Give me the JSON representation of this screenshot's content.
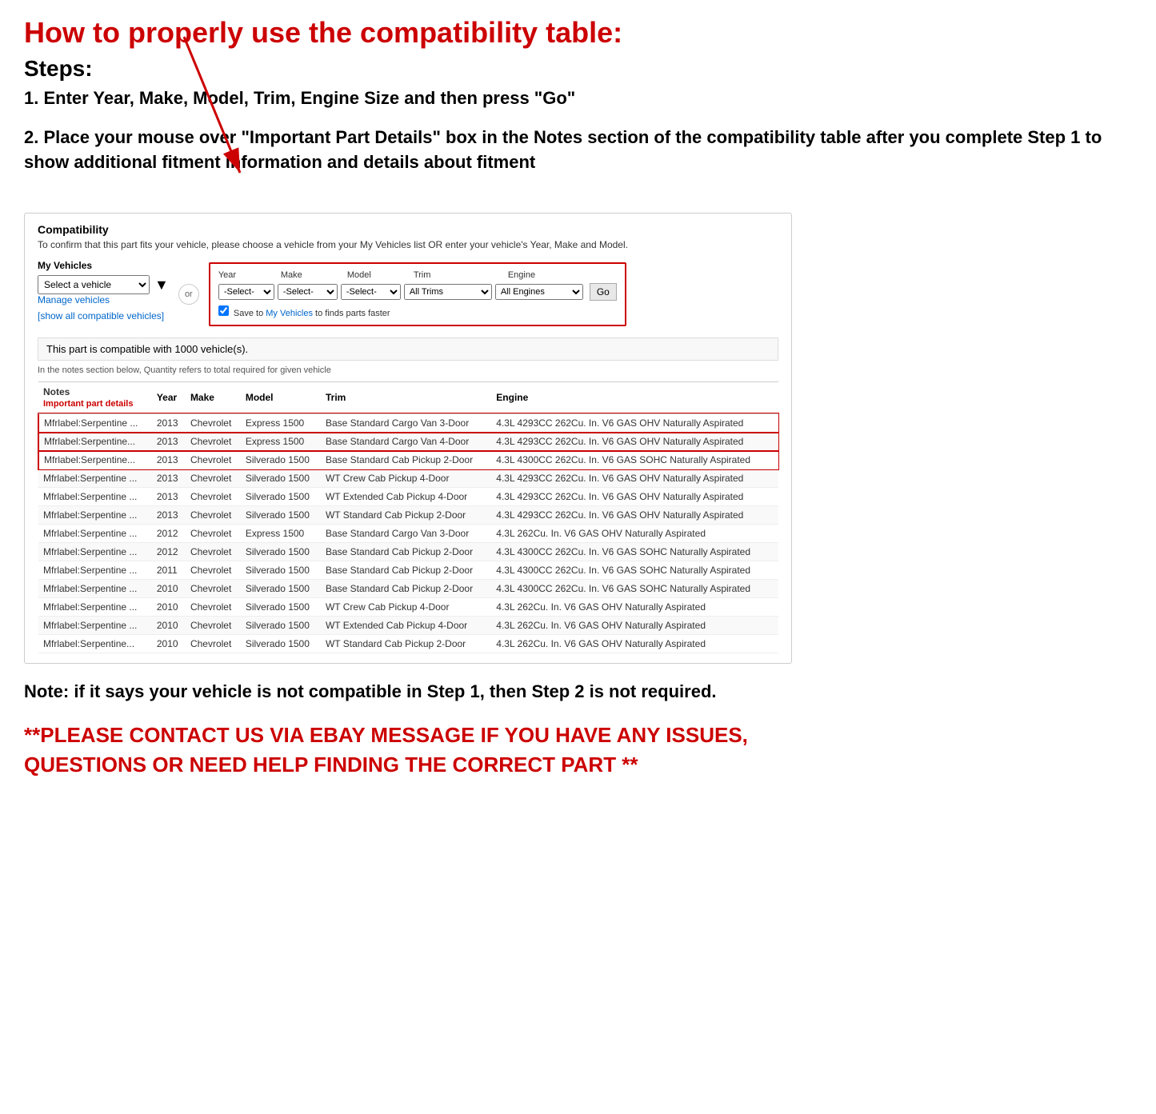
{
  "header": {
    "main_title": "How to properly use the compatibility table:",
    "steps_title": "Steps:",
    "step1": "1. Enter Year, Make, Model, Trim, Engine Size and then press \"Go\"",
    "step2": "2. Place your mouse over \"Important Part Details\" box in the Notes section of the compatibility table after you complete Step 1 to show additional fitment information and details about fitment"
  },
  "compatibility": {
    "title": "Compatibility",
    "subtitle": "To confirm that this part fits your vehicle, please choose a vehicle from your My Vehicles list OR enter your vehicle's Year, Make and Model.",
    "my_vehicles_label": "My Vehicles",
    "select_vehicle_placeholder": "Select a vehicle",
    "or_label": "or",
    "manage_vehicles": "Manage vehicles",
    "show_all": "[show all compatible vehicles]",
    "year_label": "Year",
    "make_label": "Make",
    "model_label": "Model",
    "trim_label": "Trim",
    "engine_label": "Engine",
    "year_value": "-Select-",
    "make_value": "-Select-",
    "model_value": "-Select-",
    "trim_value": "All Trims",
    "engine_value": "All Engines",
    "go_button": "Go",
    "save_text": "Save to",
    "my_vehicles_link": "My Vehicles",
    "save_suffix": "to finds parts faster",
    "count_text": "This part is compatible with 1000 vehicle(s).",
    "note_quantity": "In the notes section below, Quantity refers to total required for given vehicle",
    "table": {
      "headers": [
        "Notes",
        "Year",
        "Make",
        "Model",
        "Trim",
        "Engine"
      ],
      "notes_sub": "Important part details",
      "rows": [
        {
          "notes": "Mfrlabel:Serpentine ...",
          "year": "2013",
          "make": "Chevrolet",
          "model": "Express 1500",
          "trim": "Base Standard Cargo Van 3-Door",
          "engine": "4.3L 4293CC 262Cu. In. V6 GAS OHV Naturally Aspirated",
          "highlight": true
        },
        {
          "notes": "Mfrlabel:Serpentine...",
          "year": "2013",
          "make": "Chevrolet",
          "model": "Express 1500",
          "trim": "Base Standard Cargo Van 4-Door",
          "engine": "4.3L 4293CC 262Cu. In. V6 GAS OHV Naturally Aspirated",
          "highlight": true
        },
        {
          "notes": "Mfrlabel:Serpentine...",
          "year": "2013",
          "make": "Chevrolet",
          "model": "Silverado 1500",
          "trim": "Base Standard Cab Pickup 2-Door",
          "engine": "4.3L 4300CC 262Cu. In. V6 GAS SOHC Naturally Aspirated",
          "highlight": true
        },
        {
          "notes": "Mfrlabel:Serpentine ...",
          "year": "2013",
          "make": "Chevrolet",
          "model": "Silverado 1500",
          "trim": "WT Crew Cab Pickup 4-Door",
          "engine": "4.3L 4293CC 262Cu. In. V6 GAS OHV Naturally Aspirated",
          "highlight": false
        },
        {
          "notes": "Mfrlabel:Serpentine ...",
          "year": "2013",
          "make": "Chevrolet",
          "model": "Silverado 1500",
          "trim": "WT Extended Cab Pickup 4-Door",
          "engine": "4.3L 4293CC 262Cu. In. V6 GAS OHV Naturally Aspirated",
          "highlight": false
        },
        {
          "notes": "Mfrlabel:Serpentine ...",
          "year": "2013",
          "make": "Chevrolet",
          "model": "Silverado 1500",
          "trim": "WT Standard Cab Pickup 2-Door",
          "engine": "4.3L 4293CC 262Cu. In. V6 GAS OHV Naturally Aspirated",
          "highlight": false
        },
        {
          "notes": "Mfrlabel:Serpentine ...",
          "year": "2012",
          "make": "Chevrolet",
          "model": "Express 1500",
          "trim": "Base Standard Cargo Van 3-Door",
          "engine": "4.3L 262Cu. In. V6 GAS OHV Naturally Aspirated",
          "highlight": false
        },
        {
          "notes": "Mfrlabel:Serpentine ...",
          "year": "2012",
          "make": "Chevrolet",
          "model": "Silverado 1500",
          "trim": "Base Standard Cab Pickup 2-Door",
          "engine": "4.3L 4300CC 262Cu. In. V6 GAS SOHC Naturally Aspirated",
          "highlight": false
        },
        {
          "notes": "Mfrlabel:Serpentine ...",
          "year": "2011",
          "make": "Chevrolet",
          "model": "Silverado 1500",
          "trim": "Base Standard Cab Pickup 2-Door",
          "engine": "4.3L 4300CC 262Cu. In. V6 GAS SOHC Naturally Aspirated",
          "highlight": false
        },
        {
          "notes": "Mfrlabel:Serpentine ...",
          "year": "2010",
          "make": "Chevrolet",
          "model": "Silverado 1500",
          "trim": "Base Standard Cab Pickup 2-Door",
          "engine": "4.3L 4300CC 262Cu. In. V6 GAS SOHC Naturally Aspirated",
          "highlight": false
        },
        {
          "notes": "Mfrlabel:Serpentine ...",
          "year": "2010",
          "make": "Chevrolet",
          "model": "Silverado 1500",
          "trim": "WT Crew Cab Pickup 4-Door",
          "engine": "4.3L 262Cu. In. V6 GAS OHV Naturally Aspirated",
          "highlight": false
        },
        {
          "notes": "Mfrlabel:Serpentine ...",
          "year": "2010",
          "make": "Chevrolet",
          "model": "Silverado 1500",
          "trim": "WT Extended Cab Pickup 4-Door",
          "engine": "4.3L 262Cu. In. V6 GAS OHV Naturally Aspirated",
          "highlight": false
        },
        {
          "notes": "Mfrlabel:Serpentine...",
          "year": "2010",
          "make": "Chevrolet",
          "model": "Silverado 1500",
          "trim": "WT Standard Cab Pickup 2-Door",
          "engine": "4.3L 262Cu. In. V6 GAS OHV Naturally Aspirated",
          "highlight": false
        }
      ]
    }
  },
  "note_section": {
    "text": "Note: if it says your vehicle is not compatible in Step 1, then Step 2 is not required."
  },
  "contact_section": {
    "text": "**PLEASE CONTACT US VIA EBAY MESSAGE IF YOU HAVE ANY ISSUES, QUESTIONS OR NEED HELP FINDING THE CORRECT PART **"
  }
}
